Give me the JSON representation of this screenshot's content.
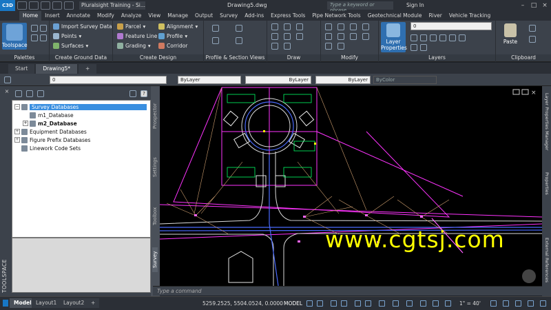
{
  "titlebar": {
    "app_logo": "C3D",
    "workspace": "Pluralsight Training - Si...",
    "doc_title": "Drawing5.dwg",
    "search_placeholder": "Type a keyword or phrase",
    "signin": "Sign In"
  },
  "ribbon_tabs": [
    "Home",
    "Insert",
    "Annotate",
    "Modify",
    "Analyze",
    "View",
    "Manage",
    "Output",
    "Survey",
    "Add-ins",
    "Express Tools",
    "Pipe Network Tools",
    "Geotechnical Module",
    "River",
    "Vehicle Tracking"
  ],
  "ribbon": {
    "toolspace_label": "Toolspace",
    "palettes_label": "Palettes",
    "import_survey": "Import Survey Data",
    "points": "Points",
    "surfaces": "Surfaces",
    "create_ground_label": "Create Ground Data",
    "parcel": "Parcel",
    "feature_line": "Feature Line",
    "grading": "Grading",
    "alignment": "Alignment",
    "profile": "Profile",
    "corridor": "Corridor",
    "create_design_label": "Create Design",
    "profile_section_label": "Profile & Section Views",
    "draw_label": "Draw",
    "modify_label": "Modify",
    "layer_properties": "Layer Properties",
    "layer_value": "0",
    "layers_label": "Layers",
    "paste": "Paste",
    "clipboard_label": "Clipboard"
  },
  "doc_tabs": {
    "start": "Start",
    "drawing": "Drawing5*",
    "add": "+"
  },
  "propbar": {
    "layer": "0",
    "color": "ByLayer",
    "linetype": "ByLayer",
    "lineweight": "ByLayer",
    "plotstyle": "ByColor"
  },
  "toolspace": {
    "vertical_label": "TOOLSPACE",
    "tree": [
      {
        "label": "Survey Databases",
        "level": 0,
        "exp": "−",
        "selected": true
      },
      {
        "label": "m1_Database",
        "level": 1,
        "exp": "",
        "selected": false
      },
      {
        "label": "m2_Database",
        "level": 1,
        "exp": "+",
        "selected": false,
        "bold": true
      },
      {
        "label": "Equipment Databases",
        "level": 0,
        "exp": "+",
        "selected": false
      },
      {
        "label": "Figure Prefix Databases",
        "level": 0,
        "exp": "+",
        "selected": false
      },
      {
        "label": "Linework Code Sets",
        "level": 0,
        "exp": "",
        "selected": false
      }
    ],
    "side_tabs": {
      "prospector": "Prospector",
      "settings": "Settings",
      "toolbox": "Toolbox",
      "survey": "Survey"
    }
  },
  "command_placeholder": "Type a command",
  "right_palettes": {
    "layer_manager": "Layer Properties Manager",
    "properties": "Properties",
    "external_refs": "External References"
  },
  "statusbar": {
    "layouts": [
      "Model",
      "Layout1",
      "Layout2"
    ],
    "add": "+",
    "coords": "5259.2525, 5504.0524, 0.0000",
    "model": "MODEL",
    "scale": "1\" = 40'"
  },
  "watermark": "www.cgtsj.com",
  "colors": {
    "accent": "#1877c4",
    "selected": "#3a8fe0",
    "watermark": "#ffff00",
    "label_green": "#00ff66"
  }
}
